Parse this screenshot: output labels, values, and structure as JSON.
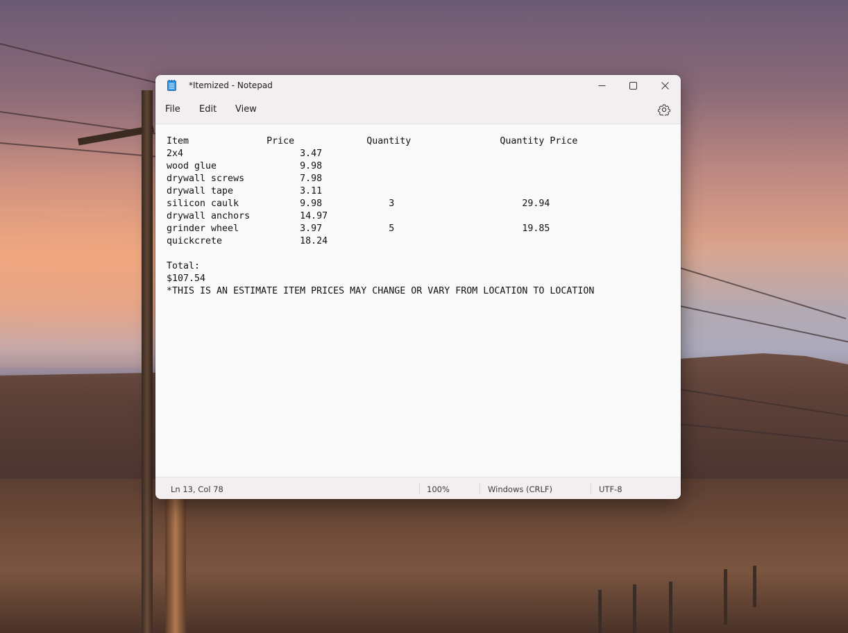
{
  "window": {
    "title": "*Itemized - Notepad",
    "app_icon": "notepad-icon"
  },
  "menu": {
    "file": "File",
    "edit": "Edit",
    "view": "View"
  },
  "editor": {
    "lines": [
      "Item              Price             Quantity                Quantity Price",
      "2x4                     3.47",
      "wood glue               9.98",
      "drywall screws          7.98",
      "drywall tape            3.11",
      "silicon caulk           9.98            3                       29.94",
      "drywall anchors         14.97",
      "grinder wheel           3.97            5                       19.85",
      "quickcrete              18.24",
      "",
      "Total:",
      "$107.54",
      "*THIS IS AN ESTIMATE ITEM PRICES MAY CHANGE OR VARY FROM LOCATION TO LOCATION"
    ]
  },
  "status": {
    "position": "Ln 13, Col 78",
    "zoom": "100%",
    "line_ending": "Windows (CRLF)",
    "encoding": "UTF-8"
  }
}
